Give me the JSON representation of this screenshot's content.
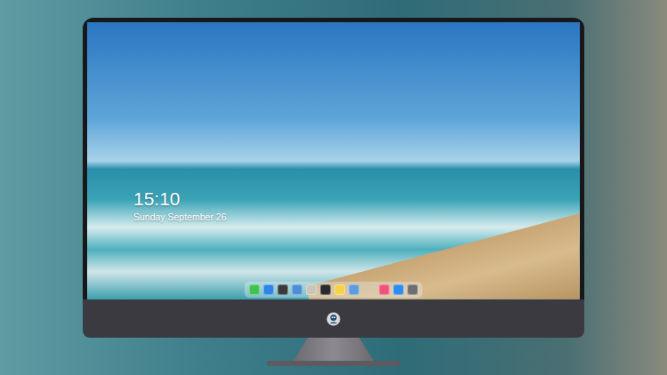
{
  "screen": {
    "clock": {
      "time": "15:10",
      "date": "Sunday September 26"
    },
    "dock": {
      "apps": [
        {
          "color": "#3fc24f"
        },
        {
          "color": "#2f86e8"
        },
        {
          "color": "#3a3a3a"
        },
        {
          "color": "#4a8fd8"
        },
        {
          "color": "#c9c6b8"
        },
        {
          "color": "#2b2b2e"
        },
        {
          "color": "#f4d24b"
        },
        {
          "color": "#5b9be0"
        }
      ],
      "extras": [
        {
          "color": "#f0527a"
        },
        {
          "color": "#2d8cf0"
        },
        {
          "color": "#6e6e73"
        }
      ]
    }
  }
}
